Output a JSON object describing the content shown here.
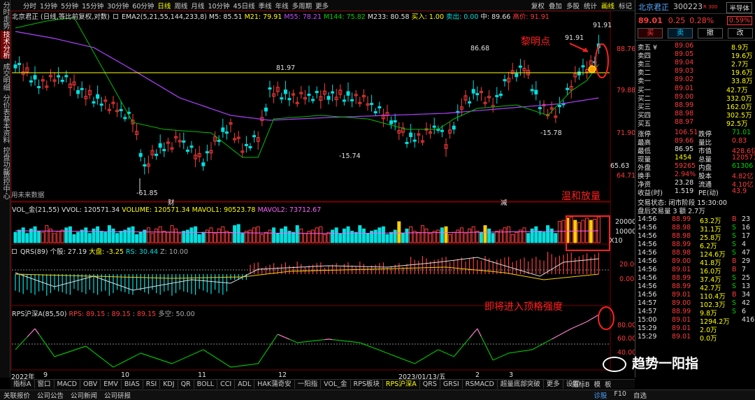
{
  "left_tabs": [
    "分时走势",
    "技术分析",
    "成交明细",
    "分价表",
    "基本资料",
    "控盘功能",
    "运控中心"
  ],
  "top_periods": [
    "分时",
    "1分钟",
    "5分钟",
    "15分钟",
    "30分钟",
    "60分钟",
    "日线",
    "周线",
    "月线",
    "10分钟",
    "45日线",
    "季线",
    "年线",
    "多周期",
    "更多"
  ],
  "active_period": "日线",
  "toolbar_right": [
    "复权",
    "叠加",
    "多股",
    "统计",
    "画线",
    "标记"
  ],
  "active_tool": "画线",
  "main_legend": {
    "title": "北京君正 (日线,等比前复权,对数)",
    "ema": "EMA2(5,21,55,144,233,8)",
    "m5": "M5: 85.51",
    "m21": "M21: 79.91",
    "m55": "M55: 78.21",
    "m144": "M144: 75.82",
    "m233": "M233: 80.58",
    "buy": "买入: 1.00",
    "sell": "卖出: 0.00",
    "mid": "中: 89.66",
    "high": "高价: 91.91"
  },
  "main_y_ticks": [
    "88.76",
    "79.88",
    "71.90",
    "64.71"
  ],
  "main_marks": {
    "hi_right": "91.91",
    "hi_label": "91.91",
    "mid_peak": "86.68",
    "line_val": "81.97",
    "low1": "-15.74",
    "low2": "-15.78",
    "low3": "-61.85",
    "current": "65.63"
  },
  "main_footer": "用未来数据",
  "cai": "财",
  "jian": "减",
  "vol_legend": {
    "name": "VOL_金(21,55)",
    "vvol": "VVOL: 120571.34",
    "volume": "VOLUME: 120571.34",
    "mavol1": "MAVOL1: 90523.78",
    "mavol2": "MAVOL2: 73712.67"
  },
  "vol_y_ticks": [
    "20000",
    "10000",
    "X10"
  ],
  "qrs_legend": {
    "name": "QRS(89)",
    "g": "个股: 27.19",
    "d": "大盘: -3.25",
    "rs": "RS: 30.44",
    "z": "Z: 10.00"
  },
  "qrs_y_ticks": [
    "20.00",
    "0.00"
  ],
  "rps_legend": {
    "name": "RPS沪深A(85,50)",
    "rps": "RPS: 89.15",
    "v1": "89.15",
    "v2": "89.15",
    "ks": "多空: 50.00"
  },
  "rps_y_ticks": [
    "80.00",
    "60.00",
    "40.00"
  ],
  "x_labels": [
    "2022年",
    "9",
    "10",
    "11",
    "12",
    "2023/01/13/五",
    "2",
    "3"
  ],
  "annotations": {
    "dawn": "黎明点",
    "vol_up": "温和放量",
    "top": "即将进入顶格强度"
  },
  "watermark": "趋势一阳指",
  "bottom_tabs": [
    "指标A",
    "窗口",
    "MACD",
    "OBV",
    "EMV",
    "BIAS",
    "RSI",
    "KDJ",
    "QR",
    "BOLL",
    "CCI",
    "ADL",
    "HAK蒲奇安",
    "一阳指",
    "VOL_金",
    "RPS板块",
    "RPS沪深A",
    "QRS",
    "GRSI",
    "RSMACD",
    "超量底部突破",
    "更多",
    "设置"
  ],
  "active_bottom_tab": "RPS沪深A",
  "bottom_right": [
    "指标B",
    "模",
    "板"
  ],
  "status_bar": [
    "关联报价",
    "公司公告",
    "公司新闻",
    "公司研报"
  ],
  "status_right": [
    "诊股",
    "F10",
    "自选"
  ],
  "quote": {
    "name": "北京君正",
    "code": "300223",
    "tag": "R 300",
    "sector": "半导体",
    "price": "89.01",
    "chg": "0.25",
    "pct": "0.28%",
    "sector_pct": "0.59%",
    "btn_buy": "买",
    "btn_sell": "卖",
    "btn_cancel": "撤",
    "btn_change": "改",
    "asks": [
      [
        "卖五 ¥",
        "89.06",
        "8.9万"
      ],
      [
        "卖四",
        "89.05",
        "19.6万"
      ],
      [
        "卖三",
        "89.04",
        "2.7万"
      ],
      [
        "卖二",
        "89.03",
        "19.6万"
      ],
      [
        "卖一",
        "89.02",
        "33.8万"
      ]
    ],
    "bids": [
      [
        "买一",
        "89.01",
        "42.7万"
      ],
      [
        "买二",
        "89.00",
        "332.0万"
      ],
      [
        "买三",
        "88.99",
        "162.0万"
      ],
      [
        "买四",
        "88.98",
        "302.5万"
      ],
      [
        "买五",
        "88.97",
        "92.5万"
      ]
    ],
    "stats": [
      [
        "涨停",
        "106.51",
        "跌停",
        "71.01"
      ],
      [
        "最高",
        "89.66",
        "量比",
        "0.83"
      ],
      [
        "最低",
        "86.95",
        "市值",
        "428.6亿"
      ],
      [
        "现量",
        "1454",
        "总量",
        "120571"
      ],
      [
        "外盘",
        "59265",
        "内盘",
        "61306"
      ],
      [
        "换手",
        "2.94%",
        "股本",
        "4.82亿"
      ],
      [
        "净资",
        "23.28",
        "流通",
        "4.10亿"
      ],
      [
        "收益(时)",
        "1.519",
        "PE(动)",
        "43.9"
      ]
    ],
    "trade_state": "交易状态: 闭市阶段 15:30:00",
    "after_hours": "盘后交易量 3 额 2.7万",
    "ticks": [
      [
        "14:56",
        "88.99",
        "63.2万",
        "B",
        "23"
      ],
      [
        "14:56",
        "88.98",
        "31.1万",
        "S",
        "16"
      ],
      [
        "14:56",
        "88.98",
        "25.8万",
        "S",
        "17"
      ],
      [
        "14:56",
        "88.99",
        "6.2万",
        "S",
        "4"
      ],
      [
        "14:56",
        "88.98",
        "124.6万",
        "S",
        "47"
      ],
      [
        "14:56",
        "89.00",
        "41.8万",
        "B",
        "29"
      ],
      [
        "14:56",
        "89.01",
        "16.0万",
        "B",
        "7"
      ],
      [
        "14:56",
        "88.99",
        "37.4万",
        "S",
        "25"
      ],
      [
        "14:56",
        "88.99",
        "42.7万",
        "S",
        "13"
      ],
      [
        "14:56",
        "89.01",
        "110.4万",
        "B",
        "34"
      ],
      [
        "14:57",
        "89.00",
        "102.3万",
        "S",
        "42"
      ],
      [
        "14:57",
        "88.99",
        "9.8万",
        "S",
        "6"
      ],
      [
        "15:00",
        "89.01",
        "1294.2万",
        "",
        "416"
      ],
      [
        "15:29",
        "89.01",
        "2.0万",
        "",
        ""
      ],
      [
        "15:29",
        "89.01",
        "0.0万",
        "",
        ""
      ]
    ]
  },
  "colors": {
    "up": "#ff3b3b",
    "down": "#00e0e0",
    "yellow": "#ffff00",
    "magenta": "#b040ff",
    "green": "#00c000"
  }
}
